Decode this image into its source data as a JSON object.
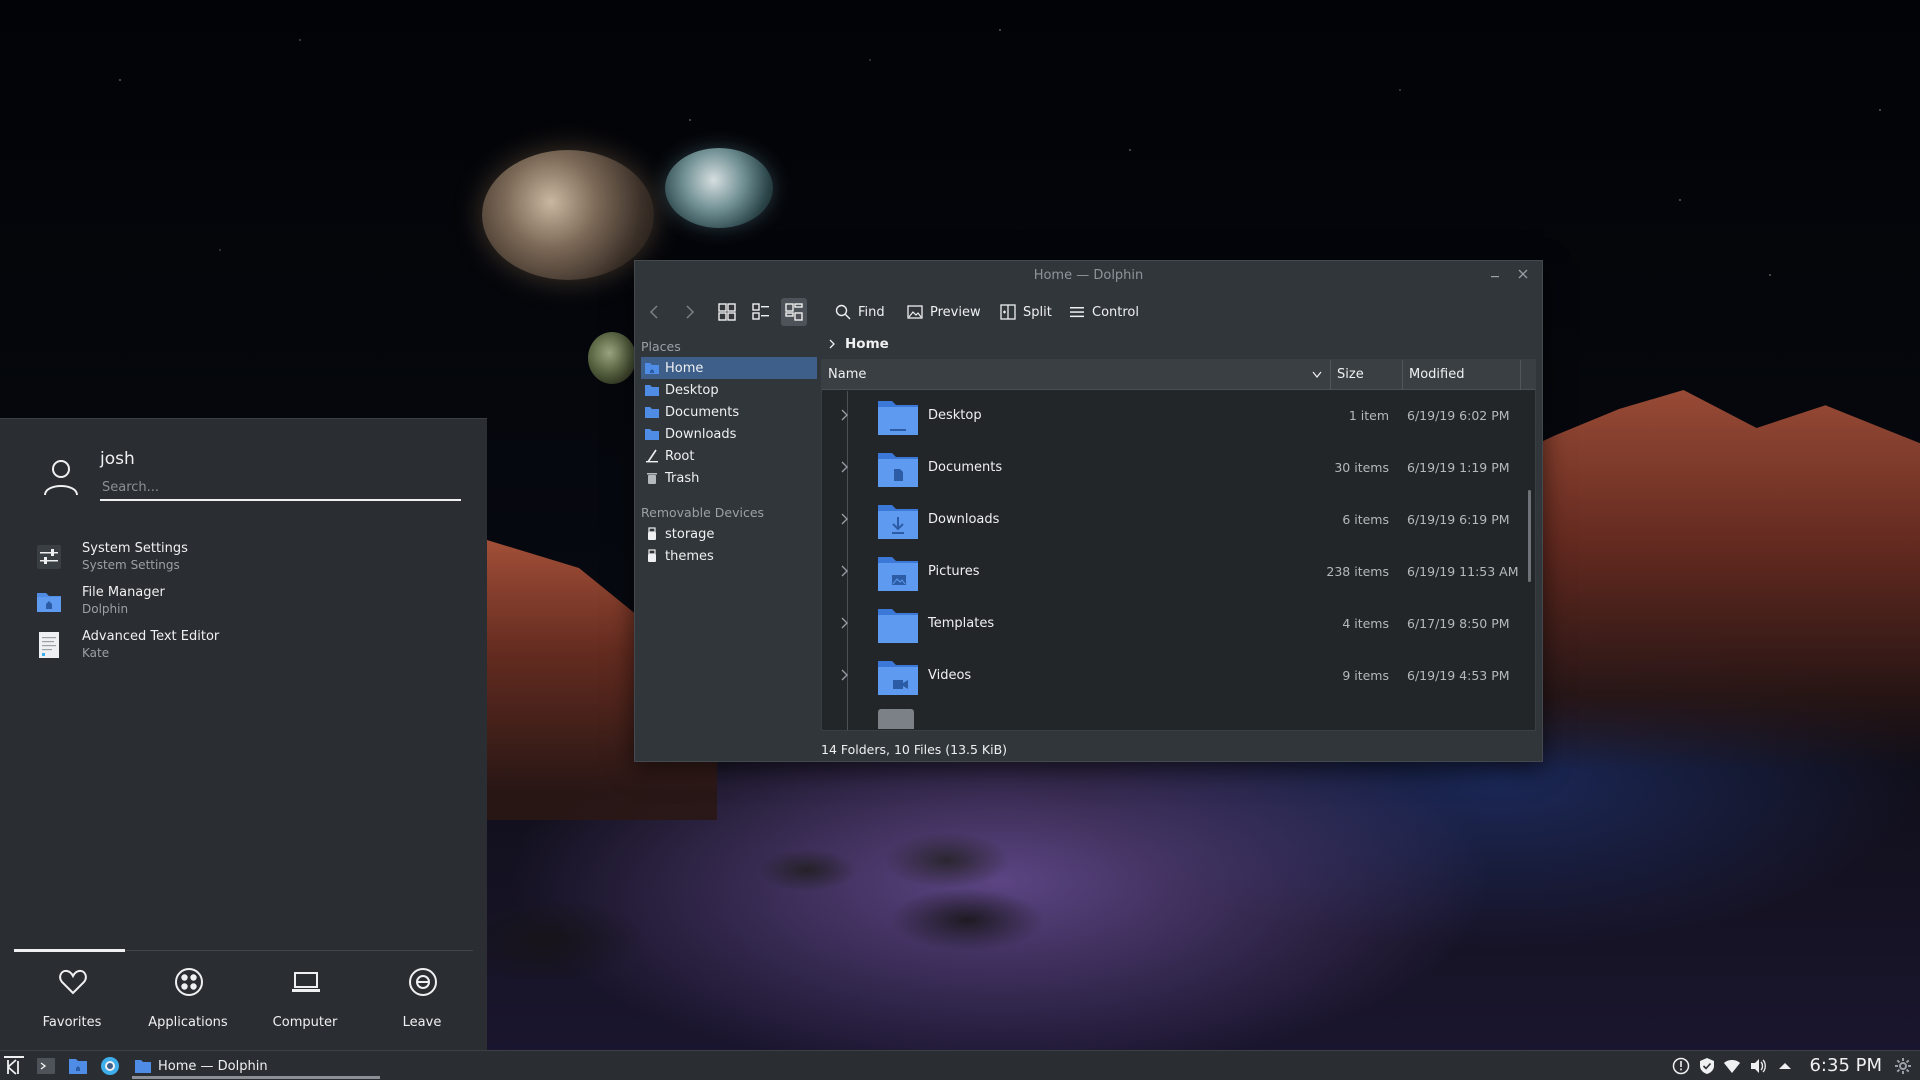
{
  "launcher": {
    "username": "josh",
    "search_placeholder": "Search...",
    "favorites": [
      {
        "name": "System Settings",
        "desc": "System Settings",
        "icon": "settings-sliders-icon"
      },
      {
        "name": "File Manager",
        "desc": "Dolphin",
        "icon": "folder-icon"
      },
      {
        "name": "Advanced Text Editor",
        "desc": "Kate",
        "icon": "text-editor-icon"
      }
    ],
    "tabs": [
      {
        "label": "Favorites",
        "icon": "heart-icon"
      },
      {
        "label": "Applications",
        "icon": "grid-icon"
      },
      {
        "label": "Computer",
        "icon": "laptop-icon"
      },
      {
        "label": "Leave",
        "icon": "power-icon"
      }
    ]
  },
  "dolphin": {
    "title": "Home — Dolphin",
    "toolbar": {
      "find": "Find",
      "preview": "Preview",
      "split": "Split",
      "control": "Control"
    },
    "places_heading": "Places",
    "places": [
      "Home",
      "Desktop",
      "Documents",
      "Downloads",
      "Root",
      "Trash"
    ],
    "removable_heading": "Removable Devices",
    "removable": [
      "storage",
      "themes"
    ],
    "breadcrumb": "Home",
    "columns": {
      "name": "Name",
      "size": "Size",
      "modified": "Modified"
    },
    "rows": [
      {
        "name": "Desktop",
        "size": "1 item",
        "modified": "6/19/19 6:02 PM",
        "icon": "folder-desktop-icon"
      },
      {
        "name": "Documents",
        "size": "30 items",
        "modified": "6/19/19 1:19 PM",
        "icon": "folder-documents-icon"
      },
      {
        "name": "Downloads",
        "size": "6 items",
        "modified": "6/19/19 6:19 PM",
        "icon": "folder-downloads-icon"
      },
      {
        "name": "Pictures",
        "size": "238 items",
        "modified": "6/19/19 11:53 AM",
        "icon": "folder-pictures-icon"
      },
      {
        "name": "Templates",
        "size": "4 items",
        "modified": "6/17/19 8:50 PM",
        "icon": "folder-templates-icon"
      },
      {
        "name": "Videos",
        "size": "9 items",
        "modified": "6/19/19 4:53 PM",
        "icon": "folder-videos-icon"
      }
    ],
    "status": "14 Folders, 10 Files (13.5 KiB)"
  },
  "taskbar": {
    "task_title": "Home — Dolphin",
    "clock": "6:35 PM"
  },
  "colors": {
    "accent": "#3d5f8a",
    "folder": "#4f8ce6",
    "panel": "#2a2e32",
    "window": "#31363b"
  }
}
